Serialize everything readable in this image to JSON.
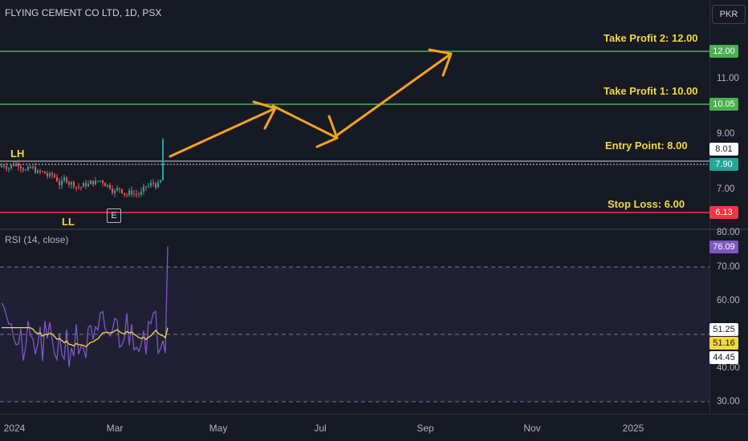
{
  "header": {
    "title": "FLYING CEMENT CO LTD, 1D, PSX",
    "currency": "PKR"
  },
  "price_axis": {
    "ticks": [
      "12.00",
      "11.00",
      "10.00",
      "9.00",
      "8.00",
      "7.00"
    ]
  },
  "levels": {
    "tp2": {
      "label": "Take Profit 2: 12.00",
      "badge": "12.00",
      "color": "#4caf50"
    },
    "tp1": {
      "label": "Take Profit 1: 10.00",
      "badge": "10.05",
      "color": "#4caf50"
    },
    "entry": {
      "label": "Entry Point: 8.00",
      "badge_top": "8.01",
      "badge": "7.90",
      "color": "#ffffff"
    },
    "stop": {
      "label": "Stop Loss: 6.00",
      "badge": "6.13",
      "color": "#f23645"
    }
  },
  "annotations": {
    "lh": "LH",
    "ll": "LL",
    "earnings_marker": "E"
  },
  "rsi": {
    "title": "RSI (14, close)",
    "ticks": [
      "80.00",
      "70.00",
      "60.00",
      "50.00",
      "40.00",
      "30.00"
    ],
    "badges": {
      "rsi": "76.09",
      "upper": "51.25",
      "ma": "51.16",
      "lower": "44.45"
    },
    "colors": {
      "line": "#7e57c2",
      "ma": "#f5d742",
      "band": "#7e57c2"
    }
  },
  "time_axis": {
    "labels": [
      "2024",
      "Mar",
      "May",
      "Jul",
      "Sep",
      "Nov",
      "2025"
    ]
  },
  "colors": {
    "arrow": "#f7a21b",
    "up": "#26a69a",
    "down": "#ef5350",
    "bg": "#161a25"
  }
}
